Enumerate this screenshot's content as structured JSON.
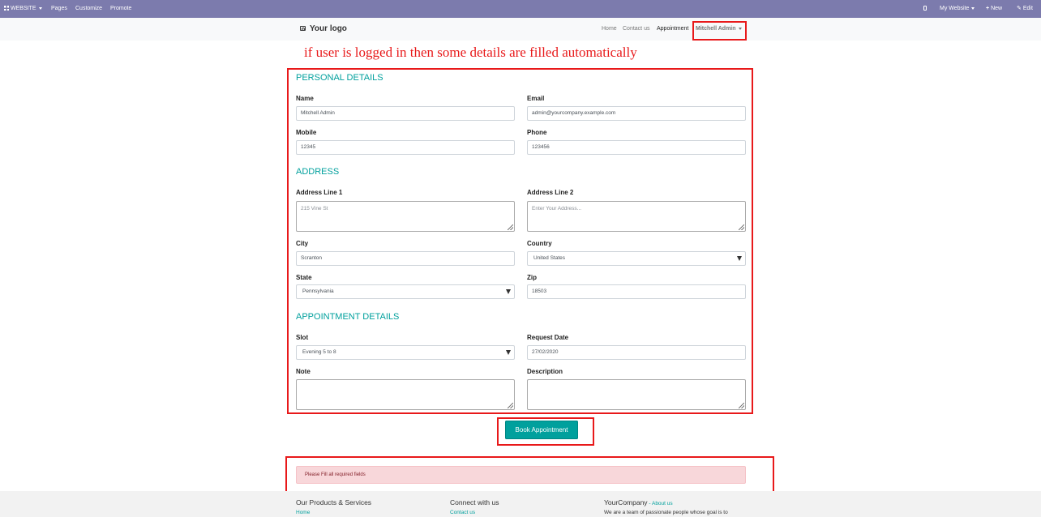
{
  "adminbar": {
    "website_label": "WEBSITE",
    "pages": "Pages",
    "customize": "Customize",
    "promote": "Promote",
    "my_website": "My Website",
    "new": "New",
    "edit": "Edit"
  },
  "header": {
    "logo": "Your logo",
    "nav": [
      "Home",
      "Contact us",
      "Appointment"
    ],
    "user": "Mitchell Admin"
  },
  "annotation": "if user is logged in then some details are filled automatically",
  "form": {
    "personal_title": "PERSONAL DETAILS",
    "address_title": "ADDRESS",
    "appointment_title": "APPOINTMENT DETAILS",
    "name": {
      "label": "Name",
      "value": "Mitchell Admin"
    },
    "email": {
      "label": "Email",
      "value": "admin@yourcompany.example.com"
    },
    "mobile": {
      "label": "Mobile",
      "value": "12345"
    },
    "phone": {
      "label": "Phone",
      "value": "123456"
    },
    "address1": {
      "label": "Address Line 1",
      "value": "215 Vine St"
    },
    "address2": {
      "label": "Address Line 2",
      "placeholder": "Enter Your Address..."
    },
    "city": {
      "label": "City",
      "value": "Scranton"
    },
    "country": {
      "label": "Country",
      "value": "United States"
    },
    "state": {
      "label": "State",
      "value": "Pennsylvania"
    },
    "zip": {
      "label": "Zip",
      "value": "18503"
    },
    "slot": {
      "label": "Slot",
      "value": "Evening 5 to 8"
    },
    "request_date": {
      "label": "Request Date",
      "value": "27/02/2020"
    },
    "note": {
      "label": "Note",
      "value": ""
    },
    "description": {
      "label": "Description",
      "value": ""
    },
    "submit": "Book Appointment"
  },
  "alert": "Please Fill all required fields",
  "footer": {
    "col1_title": "Our Products & Services",
    "col1_link": "Home",
    "col2_title": "Connect with us",
    "col2_link": "Contact us",
    "col3_title": "YourCompany",
    "col3_sep": " - ",
    "col3_link": "About us",
    "col3_text": "We are a team of passionate people whose goal is to"
  },
  "colors": {
    "adminbar": "#7c7bad",
    "accent": "#00a09d",
    "annotation_red": "#e8191a",
    "alert_bg": "#f8d7da"
  }
}
